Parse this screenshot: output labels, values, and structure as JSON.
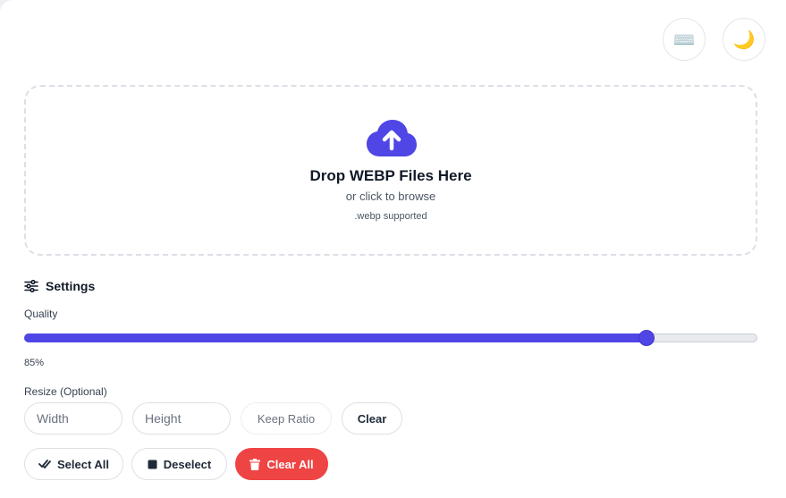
{
  "header": {
    "keyboard_icon_glyph": "⌨️",
    "theme_icon_glyph": "🌙"
  },
  "dropzone": {
    "title": "Drop WEBP Files Here",
    "subtitle": "or click to browse",
    "hint": ".webp supported",
    "accent_color": "#4f46e5"
  },
  "settings": {
    "title": "Settings",
    "quality": {
      "label": "Quality",
      "value": 85,
      "value_text": "85%"
    },
    "resize": {
      "label": "Resize (Optional)",
      "width_placeholder": "Width",
      "height_placeholder": "Height",
      "width_value": "",
      "height_value": "",
      "keep_ratio_label": "Keep Ratio",
      "clear_label": "Clear"
    }
  },
  "actions": {
    "select_all_label": "Select All",
    "deselect_label": "Deselect",
    "clear_all_label": "Clear All",
    "danger_color": "#ef4444"
  }
}
